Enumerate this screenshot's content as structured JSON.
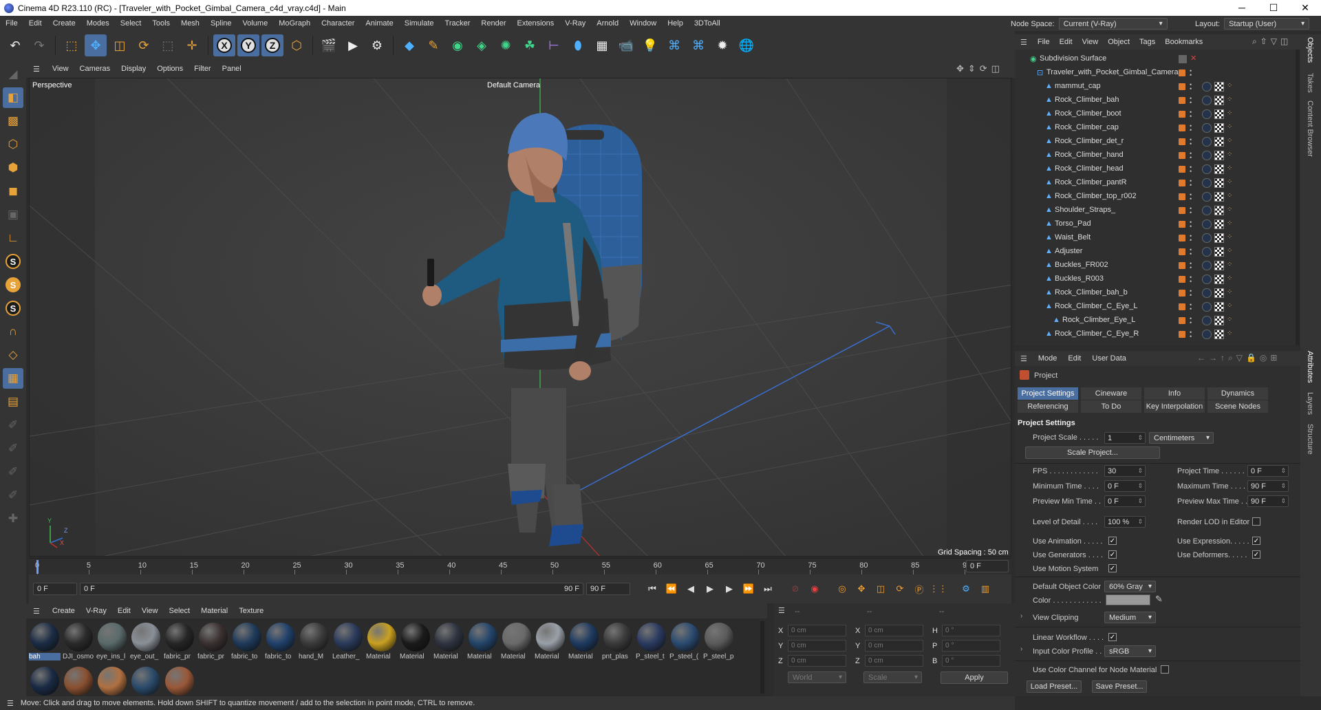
{
  "window": {
    "title": "Cinema 4D R23.110 (RC) - [Traveler_with_Pocket_Gimbal_Camera_c4d_vray.c4d] - Main",
    "min": "─",
    "max": "☐",
    "close": "✕"
  },
  "menubar": {
    "items": [
      "File",
      "Edit",
      "Create",
      "Modes",
      "Select",
      "Tools",
      "Mesh",
      "Spline",
      "Volume",
      "MoGraph",
      "Character",
      "Animate",
      "Simulate",
      "Tracker",
      "Render",
      "Extensions",
      "V-Ray",
      "Arnold",
      "Window",
      "Help",
      "3DToAll"
    ],
    "node_space_label": "Node Space:",
    "node_space_value": "Current (V-Ray)",
    "layout_label": "Layout:",
    "layout_value": "Startup (User)"
  },
  "viewport": {
    "menu": [
      "View",
      "Cameras",
      "Display",
      "Options",
      "Filter",
      "Panel"
    ],
    "view_name": "Perspective",
    "camera": "Default Camera",
    "grid_spacing": "Grid Spacing : 50 cm",
    "axis_y": "Y",
    "axis_z": "Z",
    "axis_x": "X"
  },
  "timeline": {
    "ticks": [
      "0",
      "5",
      "10",
      "15",
      "20",
      "25",
      "30",
      "35",
      "40",
      "45",
      "50",
      "55",
      "60",
      "65",
      "70",
      "75",
      "80",
      "85",
      "90"
    ],
    "current_frame": "0 F",
    "start": "0 F",
    "range_start": "0 F",
    "range_end": "90 F",
    "end": "90 F",
    "right_frame": "0 F"
  },
  "materials": {
    "menu": [
      "Create",
      "V-Ray",
      "Edit",
      "View",
      "Select",
      "Material",
      "Texture"
    ],
    "items": [
      {
        "name": "bah",
        "color": "#1b2c44"
      },
      {
        "name": "DJI_osmo",
        "color": "#2a2a2a"
      },
      {
        "name": "eye_ins_l",
        "color": "#5a6a6a"
      },
      {
        "name": "eye_out_",
        "color": "#8a9098"
      },
      {
        "name": "fabric_pr",
        "color": "#262626"
      },
      {
        "name": "fabric_pr",
        "color": "#3a3030"
      },
      {
        "name": "fabric_to",
        "color": "#1e3a5a"
      },
      {
        "name": "fabric_to",
        "color": "#20406a"
      },
      {
        "name": "hand_M",
        "color": "#3a3a3a"
      },
      {
        "name": "Leather_",
        "color": "#2a3a5a"
      },
      {
        "name": "Material",
        "color": "#c9a020"
      },
      {
        "name": "Material",
        "color": "#1a1a1a"
      },
      {
        "name": "Material",
        "color": "#2e3440"
      },
      {
        "name": "Material",
        "color": "#23456a"
      },
      {
        "name": "Material",
        "color": "#6a6a6a"
      },
      {
        "name": "Material",
        "color": "#9aa0a8"
      },
      {
        "name": "Material",
        "color": "#1e3a60"
      },
      {
        "name": "pnt_plas",
        "color": "#3a3a3a"
      },
      {
        "name": "P_steel_t",
        "color": "#2a3a60"
      },
      {
        "name": "P_steel_(",
        "color": "#2a4a70"
      },
      {
        "name": "P_steel_p",
        "color": "#5a5a5a"
      },
      {
        "name": "",
        "color": "#1a2a44"
      },
      {
        "name": "",
        "color": "#8a5030"
      },
      {
        "name": "",
        "color": "#b07040"
      },
      {
        "name": "",
        "color": "#2a4a6a"
      },
      {
        "name": "",
        "color": "#9a5838"
      }
    ]
  },
  "coords": {
    "header_a": "--",
    "header_b": "--",
    "header_c": "--",
    "x": "0 cm",
    "y": "0 cm",
    "z": "0 cm",
    "sx": "0 cm",
    "sy": "0 cm",
    "sz": "0 cm",
    "h": "0 °",
    "p": "0 °",
    "b": "0 °",
    "lbl_x": "X",
    "lbl_y": "Y",
    "lbl_z": "Z",
    "lbl_h": "H",
    "lbl_p": "P",
    "lbl_b": "B",
    "world": "World",
    "scale": "Scale",
    "apply": "Apply"
  },
  "status": "Move: Click and drag to move elements. Hold down SHIFT to quantize movement / add to the selection in point mode, CTRL to remove.",
  "objects": {
    "menu": [
      "File",
      "Edit",
      "View",
      "Object",
      "Tags",
      "Bookmarks"
    ],
    "root": "Subdivision Surface",
    "group": "Traveler_with_Pocket_Gimbal_Camera",
    "items": [
      "mammut_cap",
      "Rock_Climber_bah",
      "Rock_Climber_boot",
      "Rock_Climber_cap",
      "Rock_Climber_det_r",
      "Rock_Climber_hand",
      "Rock_Climber_head",
      "Rock_Climber_pantR",
      "Rock_Climber_top_r002",
      "Shoulder_Straps_",
      "Torso_Pad",
      "Waist_Belt",
      "Adjuster",
      "Buckles_FR002",
      "Buckles_R003",
      "Rock_Climber_bah_b",
      "Rock_Climber_C_Eye_L",
      "Rock_Climber_Eye_L",
      "Rock_Climber_C_Eye_R"
    ]
  },
  "side_tabs": [
    "Objects",
    "Takes",
    "Content Browser",
    "Attributes",
    "Layers",
    "Structure"
  ],
  "attributes": {
    "menu": [
      "Mode",
      "Edit",
      "User Data"
    ],
    "object": "Project",
    "tabs_row1": [
      "Project Settings",
      "Cineware",
      "Info",
      "Dynamics"
    ],
    "tabs_row2": [
      "Referencing",
      "To Do",
      "Key Interpolation",
      "Scene Nodes"
    ],
    "section": "Project Settings",
    "project_scale_label": "Project Scale . . . . .",
    "project_scale_value": "1",
    "project_scale_unit": "Centimeters",
    "scale_project_btn": "Scale Project...",
    "fps_label": "FPS . . . . . . . . . . . .",
    "fps_value": "30",
    "project_time_label": "Project Time . . . . . .",
    "project_time_value": "0 F",
    "min_time_label": "Minimum Time . . . .",
    "min_time_value": "0 F",
    "max_time_label": "Maximum Time . . . .",
    "max_time_value": "90 F",
    "prev_min_label": "Preview Min Time . .",
    "prev_min_value": "0 F",
    "prev_max_label": "Preview Max Time . .",
    "prev_max_value": "90 F",
    "lod_label": "Level of Detail . . . .",
    "lod_value": "100 %",
    "render_lod_label": "Render LOD in Editor",
    "use_anim_label": "Use Animation . . . . .",
    "use_expr_label": "Use Expression. . . . .",
    "use_gen_label": "Use Generators . . . .",
    "use_def_label": "Use Deformers. . . . .",
    "use_motion_label": "Use Motion System",
    "def_obj_color_label": "Default Object Color",
    "def_obj_color_value": "60% Gray",
    "color_label": "Color . . . . . . . . . . . .",
    "view_clip_label": "View Clipping",
    "view_clip_value": "Medium",
    "linear_label": "Linear Workflow . . . .",
    "input_profile_label": "Input Color Profile . .",
    "input_profile_value": "sRGB",
    "use_channel_label": "Use Color Channel for Node Material",
    "load_preset": "Load Preset...",
    "save_preset": "Save Preset...",
    "check": "✓"
  }
}
